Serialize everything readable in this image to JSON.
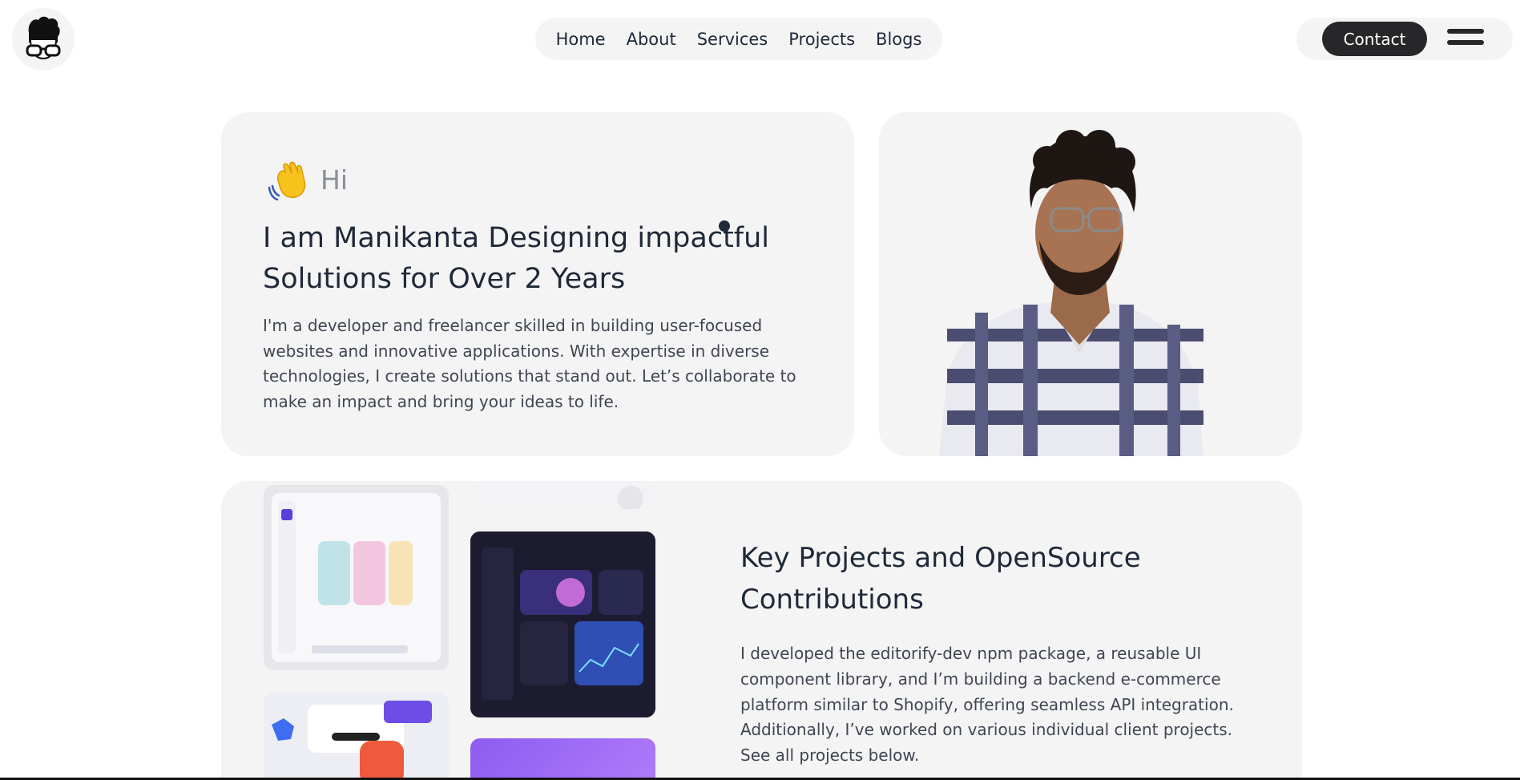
{
  "header": {
    "logo_icon": "nerd-avatar-logo",
    "nav": [
      "Home",
      "About",
      "Services",
      "Projects",
      "Blogs"
    ],
    "contact_label": "Contact",
    "menu_icon": "hamburger-icon"
  },
  "hero": {
    "wave_icon": "waving-hand-emoji",
    "greeting": "Hi",
    "title": "I am Manikanta Designing impactful Solutions for Over 2 Years",
    "description": "I'm a developer and freelancer skilled in building user-focused websites and innovative applications. With expertise in diverse technologies, I create solutions that stand out. Let’s collaborate to make an impact and bring your ideas to life."
  },
  "portrait": {
    "image": "profile-photo"
  },
  "projects": {
    "title": "Key Projects and OpenSource Contributions",
    "description": "I developed the editorify-dev npm package, a reusable UI component library, and I’m building a backend e-commerce platform similar to Shopify, offering seamless API integration. Additionally, I’ve worked on various individual client projects. See all projects below."
  },
  "colors": {
    "card_bg": "#f4f4f5",
    "dark": "#27272a",
    "text": "#1f2937",
    "muted": "#8a8f98"
  }
}
